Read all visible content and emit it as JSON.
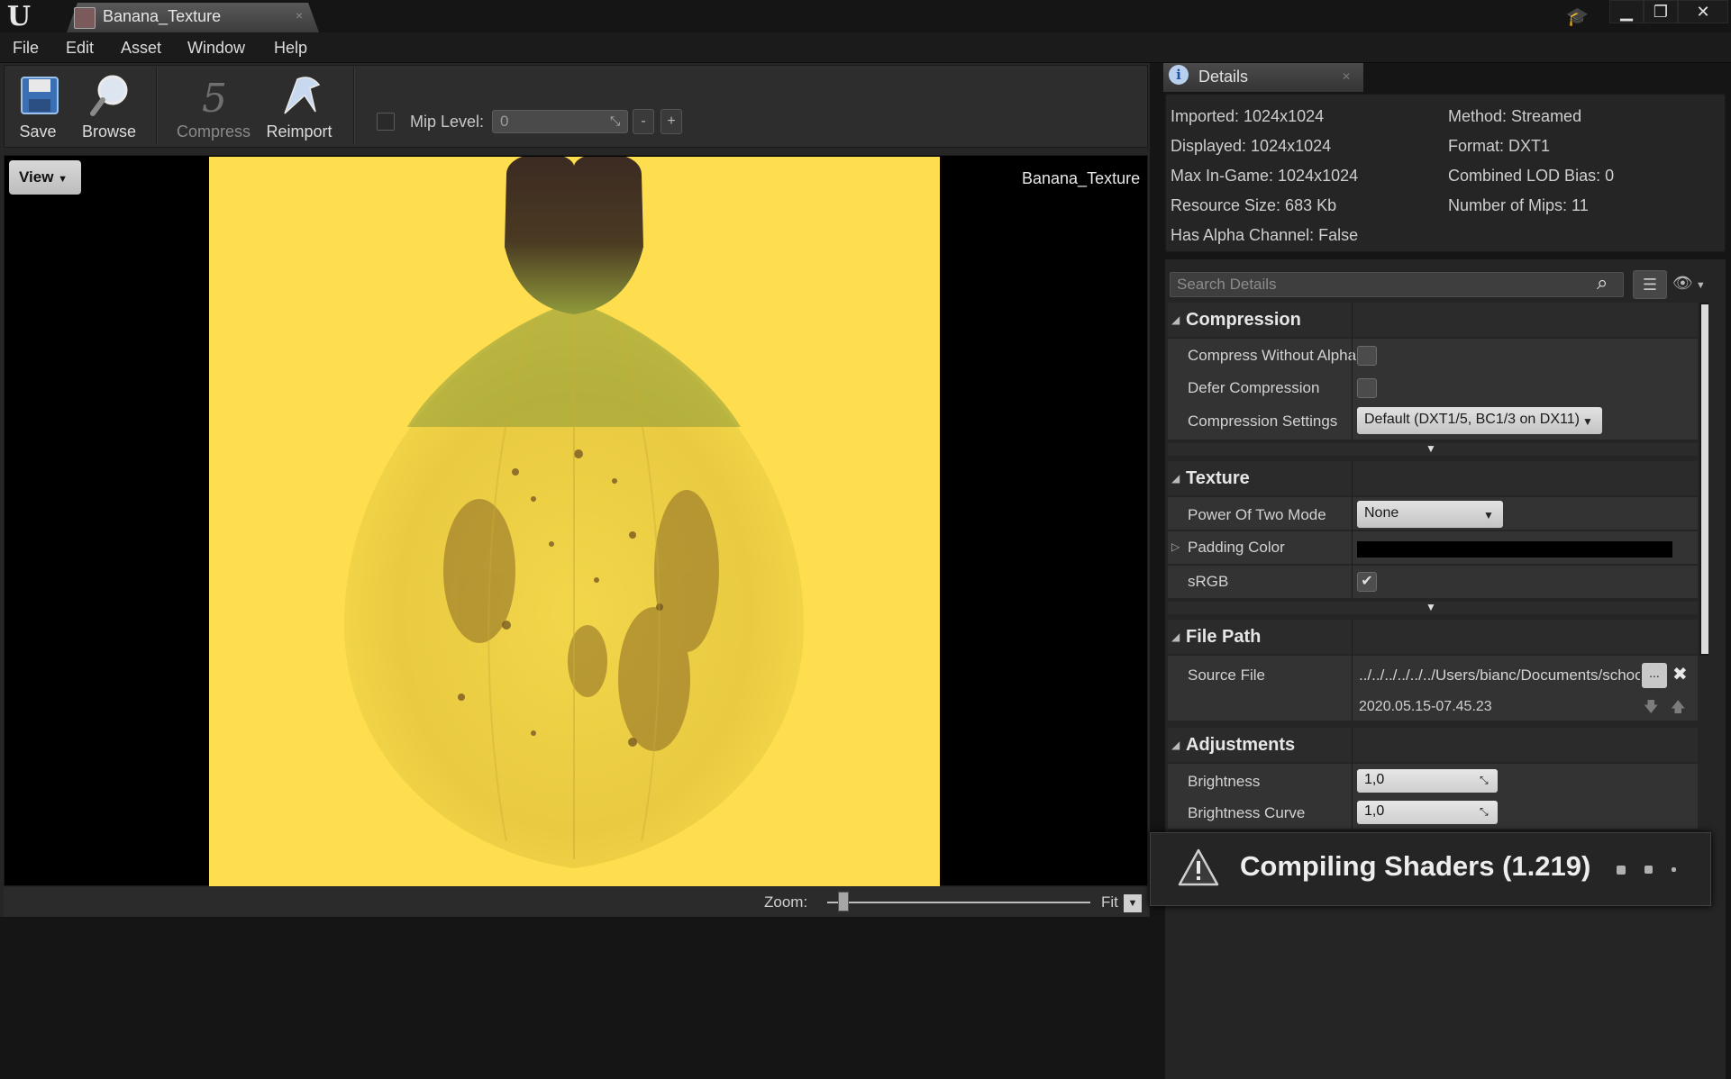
{
  "window": {
    "tab_label": "Banana_Texture",
    "tab_close": "×",
    "minimize": "▁",
    "restore": "❐",
    "close": "✕"
  },
  "menu": [
    "File",
    "Edit",
    "Asset",
    "Window",
    "Help"
  ],
  "toolbar": {
    "save": "Save",
    "browse": "Browse",
    "compress": "Compress",
    "reimport": "Reimport",
    "mip_label": "Mip Level:",
    "mip_value": "0",
    "mip_minus": "-",
    "mip_plus": "+"
  },
  "viewport": {
    "view_button": "View",
    "texture_name": "Banana_Texture",
    "zoom_label": "Zoom:",
    "zoom_value": "Fit",
    "zoom_slider_fraction": 0.06
  },
  "details": {
    "title": "Details",
    "info_left": [
      "Imported: 1024x1024",
      "Displayed: 1024x1024",
      "Max In-Game: 1024x1024",
      "Resource Size: 683 Kb",
      "Has Alpha Channel: False"
    ],
    "info_right": [
      "Method: Streamed",
      "Format: DXT1",
      "Combined LOD Bias: 0",
      "Number of Mips: 11"
    ],
    "search_placeholder": "Search Details",
    "categories": {
      "compression": {
        "title": "Compression",
        "compress_without_alpha": "Compress Without Alpha",
        "defer_compression": "Defer Compression",
        "compression_settings": "Compression Settings",
        "compression_settings_value": "Default (DXT1/5, BC1/3 on DX11)"
      },
      "texture": {
        "title": "Texture",
        "power_of_two_mode": "Power Of Two Mode",
        "power_of_two_value": "None",
        "padding_color": "Padding Color",
        "padding_color_value": "#000000",
        "srgb": "sRGB",
        "srgb_checked": true
      },
      "file_path": {
        "title": "File Path",
        "source_file": "Source File",
        "source_file_value": "../../../../../../Users/bianc/Documents/schoo",
        "source_browse": "...",
        "source_date": "2020.05.15-07.45.23"
      },
      "adjustments": {
        "title": "Adjustments",
        "brightness": "Brightness",
        "brightness_value": "1,0",
        "brightness_curve": "Brightness Curve",
        "brightness_curve_value": "1,0"
      }
    }
  },
  "toast": {
    "text": "Compiling Shaders (1.219)"
  },
  "colors": {
    "texture_background": "#fedd4e",
    "panel": "#252525",
    "accent_blue": "#7aa7d8"
  }
}
